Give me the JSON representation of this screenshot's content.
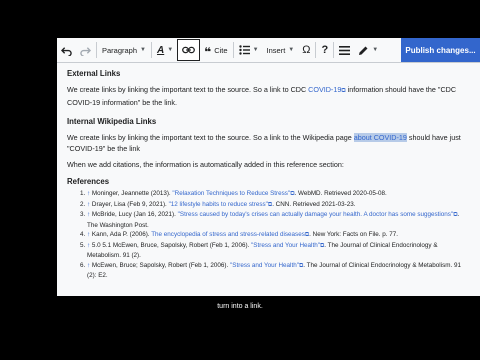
{
  "toolbar": {
    "paragraph_label": "Paragraph",
    "cite_label": "Cite",
    "insert_label": "Insert",
    "publish_label": "Publish changes..."
  },
  "content": {
    "h_external": "External Links",
    "p_external_1": "We create links by linking the important text to the source. So a link to CDC ",
    "p_external_link": "COVID-19",
    "p_external_2": " information should have the \"CDC COVID-19 information\" be the link.",
    "h_internal": "Internal Wikipedia Links",
    "p_internal_1": "We create links by linking the important text to the source. So a link to the Wikipedia page ",
    "p_internal_sel": "about COVID-19",
    "p_internal_2": " should have just \"COVID-19\" be the link",
    "p_citations": "When we add citations, the information is automatically added in this reference section:",
    "h_references": "References",
    "refs": [
      {
        "up": "↑",
        "author": "Moninger, Jeannette (2013). ",
        "title": "\"Relaxation Techniques to Reduce Stress\"",
        "rest": ". WebMD. Retrieved 2020-05-08."
      },
      {
        "up": "↑",
        "author": "Drayer, Lisa (Feb 9, 2021). ",
        "title": "\"12 lifestyle habits to reduce stress\"",
        "rest": ". CNN. Retrieved 2021-03-23."
      },
      {
        "up": "↑",
        "author": "McBride, Lucy (Jan 16, 2021). ",
        "title": "\"Stress caused by today's crises can actually damage your health. A doctor has some suggestions\"",
        "rest": ". The Washington Post."
      },
      {
        "up": "↑",
        "author": "Kann, Ada P. (2006). ",
        "title": "The encyclopedia of stress and stress-related diseases",
        "rest": ". New York: Facts on File. p. 77."
      },
      {
        "up": "↑",
        "author": "5.0 5.1 McEwen, Bruce, Sapolsky, Robert (Feb 1, 2006). ",
        "title": "\"Stress and Your Health\"",
        "rest": ". The Journal of Clinical Endocrinology & Metabolism. 91 (2)."
      },
      {
        "up": "↑",
        "author": "McEwen, Bruce; Sapolsky, Robert (Feb 1, 2006). ",
        "title": "\"Stress and Your Health\"",
        "rest": ". The Journal of Clinical Endocrinology & Metabolism. 91 (2): E2."
      }
    ]
  },
  "caption": "turn into a link."
}
